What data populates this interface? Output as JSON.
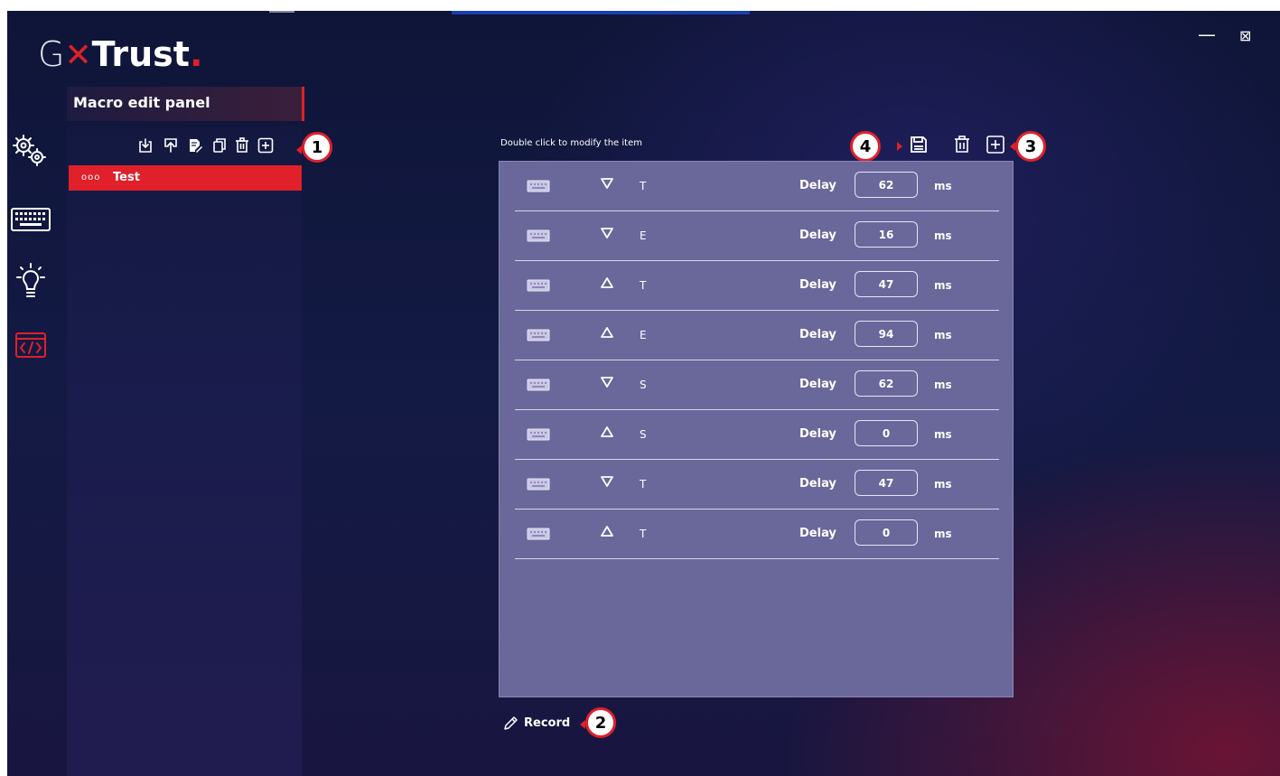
{
  "app": {
    "logo": {
      "g": "G",
      "x": "✕",
      "brand": "Trust",
      "dot": "."
    },
    "window_controls": {
      "minimize": "—",
      "close": "⊠"
    }
  },
  "sidebar": {
    "items": [
      {
        "icon": "gears-icon",
        "active": false
      },
      {
        "icon": "keyboard-icon",
        "active": false
      },
      {
        "icon": "lightbulb-icon",
        "active": false
      },
      {
        "icon": "code-icon",
        "active": true
      }
    ]
  },
  "panel": {
    "title": "Macro edit panel",
    "toolbar_icons": [
      "import-icon",
      "export-icon",
      "rename-icon",
      "copy-icon",
      "delete-icon",
      "add-icon"
    ],
    "macros": [
      {
        "dots": "ooo",
        "name": "Test",
        "selected": true
      }
    ]
  },
  "editor": {
    "hint": "Double click to modify the item",
    "toolbar_icons": [
      "save-icon",
      "delete-icon",
      "add-icon"
    ],
    "delay_label": "Delay",
    "unit": "ms",
    "rows": [
      {
        "dir": "down",
        "key": "T",
        "delay": "62"
      },
      {
        "dir": "down",
        "key": "E",
        "delay": "16"
      },
      {
        "dir": "up",
        "key": "T",
        "delay": "47"
      },
      {
        "dir": "up",
        "key": "E",
        "delay": "94"
      },
      {
        "dir": "down",
        "key": "S",
        "delay": "62"
      },
      {
        "dir": "up",
        "key": "S",
        "delay": "0"
      },
      {
        "dir": "down",
        "key": "T",
        "delay": "47"
      },
      {
        "dir": "up",
        "key": "T",
        "delay": "0"
      }
    ],
    "record_label": "Record"
  },
  "callouts": {
    "one": "1",
    "two": "2",
    "three": "3",
    "four": "4"
  },
  "colors": {
    "accent": "#e0202a",
    "list_bg": "#6a679a",
    "bg": "#131a44"
  }
}
